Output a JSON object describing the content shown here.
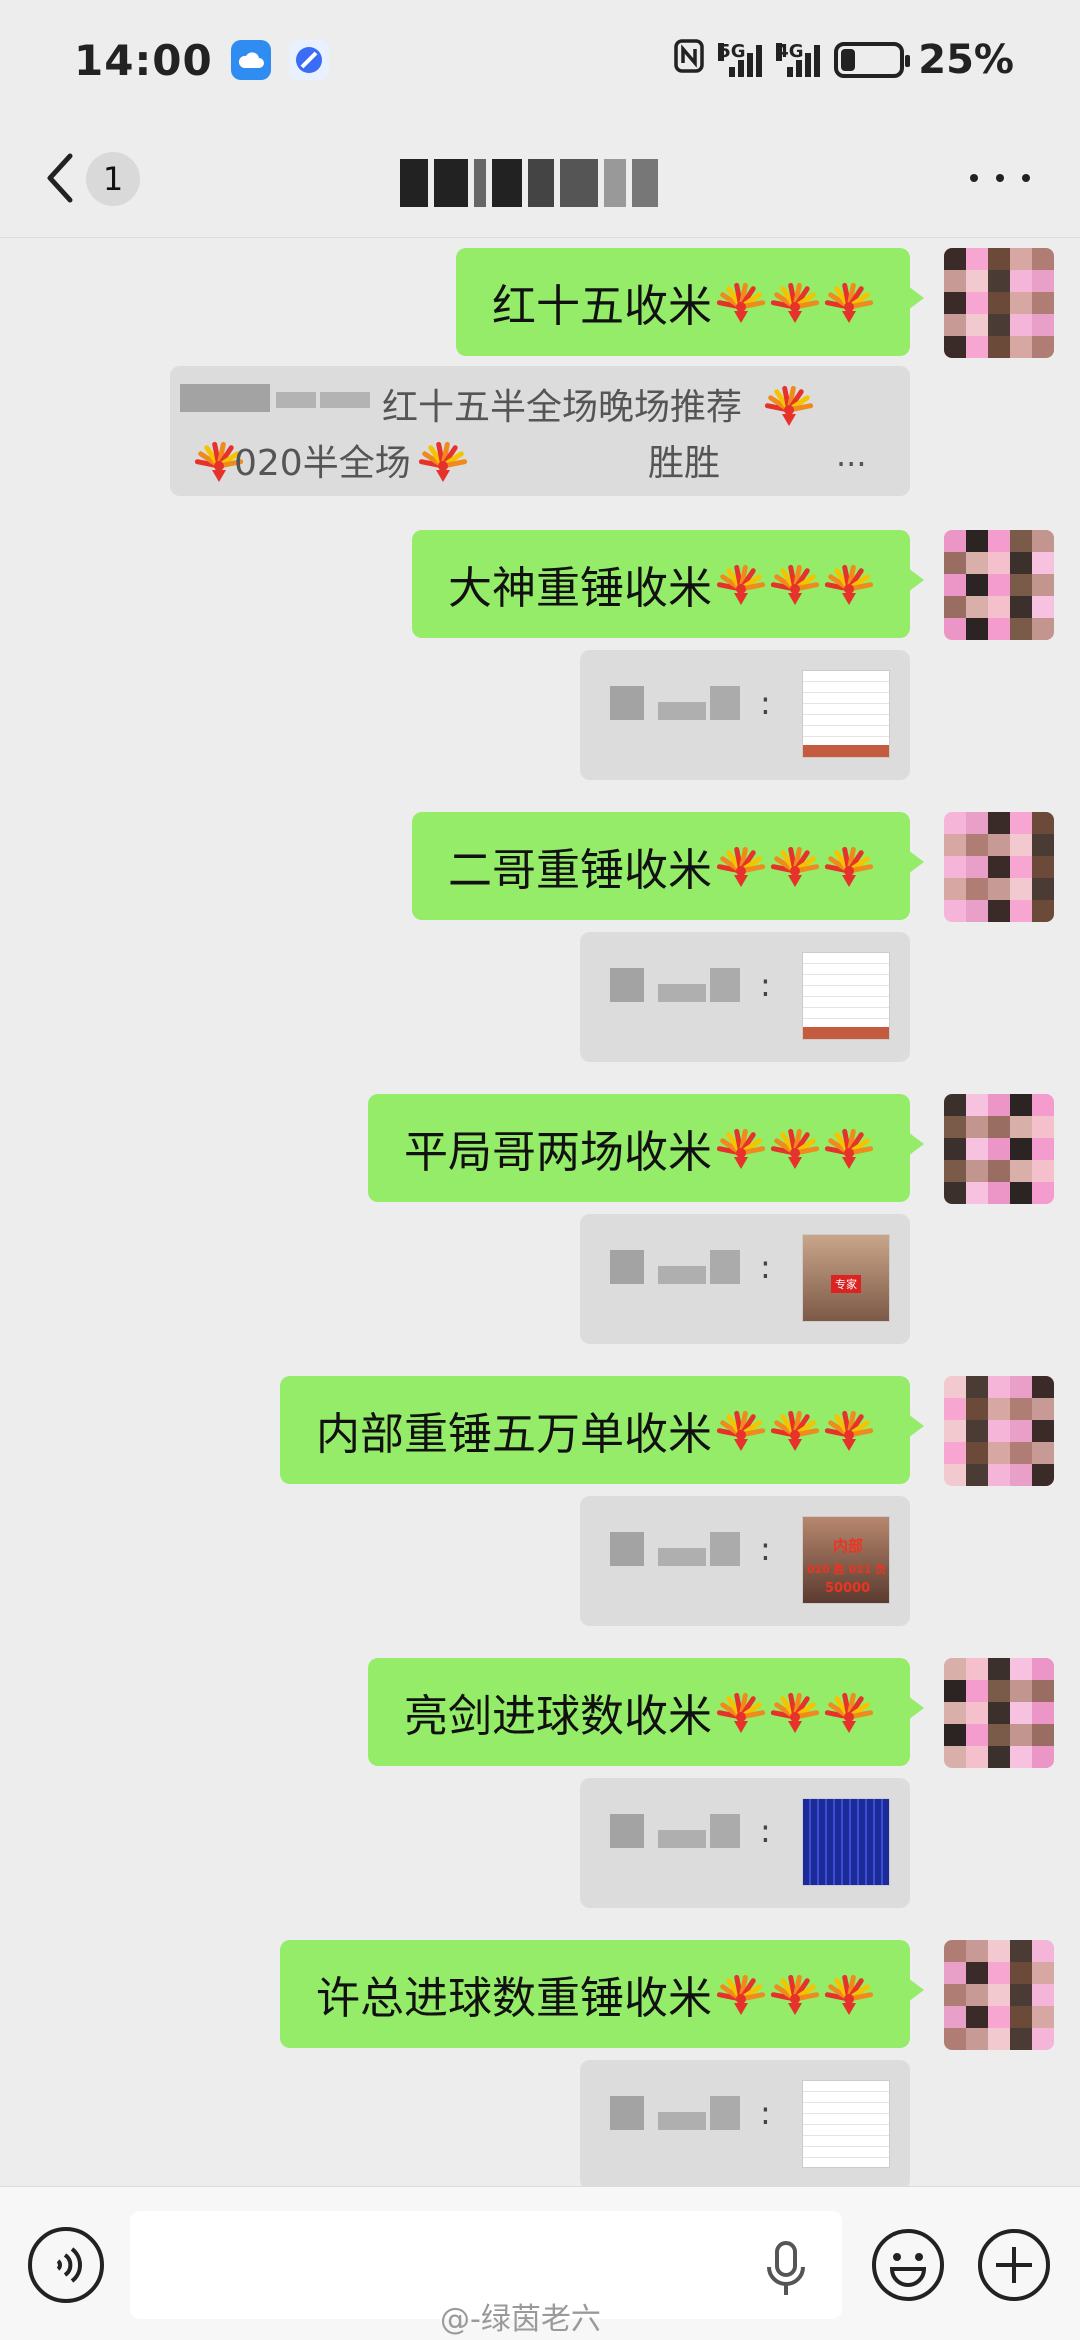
{
  "status_bar": {
    "time": "14:00",
    "network_1": "5G",
    "network_2": "4G",
    "battery_text": "25%",
    "battery_level": 0.25,
    "icons": [
      "nfc-icon",
      "signal-5g-icon",
      "signal-4g-icon",
      "battery-icon"
    ]
  },
  "header": {
    "back_icon": "chevron-left-icon",
    "unread_count": "1",
    "title": "",
    "more_icon": "more-dots-icon"
  },
  "messages": [
    {
      "text": "红十五收米",
      "fireworks": 3
    },
    {
      "text": "大神重锤收米",
      "fireworks": 3
    },
    {
      "text": "二哥重锤收米",
      "fireworks": 3
    },
    {
      "text": "平局哥两场收米",
      "fireworks": 3
    },
    {
      "text": "内部重锤五万单收米",
      "fireworks": 3
    },
    {
      "text": "亮剑进球数收米",
      "fireworks": 3
    },
    {
      "text": "许总进球数重锤收米",
      "fireworks": 3
    }
  ],
  "quotes": [
    {
      "line1": "红十五半全场晚场推荐",
      "line2a": "020半全场",
      "line2b": "胜胜",
      "dots": "..."
    },
    {
      "dots": ":"
    },
    {
      "dots": ":"
    },
    {
      "dots": ":"
    },
    {
      "dots": ":"
    },
    {
      "dots": ":"
    },
    {
      "dots": ":"
    }
  ],
  "thumbs": {
    "q5_line1": "内部",
    "q5_line2": "020 胜 021 负",
    "q5_line3": "50000",
    "q4_tag": "专家"
  },
  "bottom_bar": {
    "voice_icon": "voice-toggle-icon",
    "mic_icon": "microphone-icon",
    "emoji_icon": "emoji-icon",
    "plus_icon": "plus-icon",
    "watermark": "@-绿茵老六"
  },
  "colors": {
    "bubble": "#95ec69",
    "background": "#ededed",
    "quote_bg": "#dcdcdc"
  }
}
